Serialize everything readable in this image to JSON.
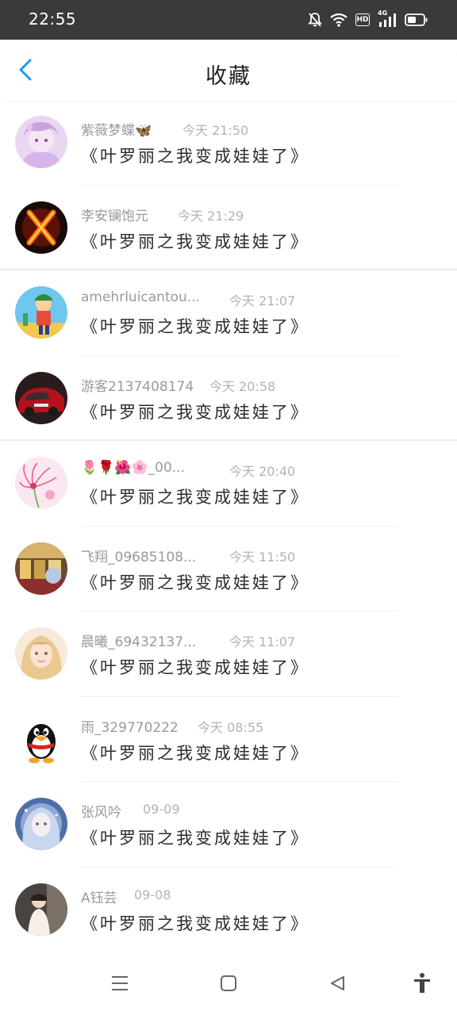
{
  "status_bar": {
    "time": "22:55",
    "hd": "HD",
    "network": "4G"
  },
  "header": {
    "title": "收藏"
  },
  "favorites": [
    {
      "name": "紫薇梦蝶🦋",
      "time": "今天 21:50",
      "content": "《叶罗丽之我变成娃娃了》",
      "avatar": "anime-girl-purple"
    },
    {
      "name": "李安镧饱元",
      "time": "今天 21:29",
      "content": "《叶罗丽之我变成娃娃了》",
      "avatar": "fire-x"
    },
    {
      "name": "amehrluicantou...",
      "time": "今天 21:07",
      "content": "《叶罗丽之我变成娃娃了》",
      "avatar": "cartoon-boy"
    },
    {
      "name": "游客2137408174",
      "time": "今天 20:58",
      "content": "《叶罗丽之我变成娃娃了》",
      "avatar": "red-car"
    },
    {
      "name": "🌷🌹🌺🌸_00...",
      "time": "今天 20:40",
      "content": "《叶罗丽之我变成娃娃了》",
      "avatar": "pink-flowers"
    },
    {
      "name": "飞翔_09685108...",
      "time": "今天 11:50",
      "content": "《叶罗丽之我变成娃娃了》",
      "avatar": "store-photo"
    },
    {
      "name": "晨曦_69432137...",
      "time": "今天 11:07",
      "content": "《叶罗丽之我变成娃娃了》",
      "avatar": "anime-girl-blonde"
    },
    {
      "name": "雨_329770222",
      "time": "今天 08:55",
      "content": "《叶罗丽之我变成娃娃了》",
      "avatar": "qq-penguin"
    },
    {
      "name": "张风吟",
      "time": "09-09",
      "content": "《叶罗丽之我变成娃娃了》",
      "avatar": "anime-girl-blue"
    },
    {
      "name": "A钰芸",
      "time": "09-08",
      "content": "《叶罗丽之我变成娃娃了》",
      "avatar": "girl-photo"
    }
  ],
  "colors": {
    "accent": "#2196F3",
    "status_bar": "#3a3a3a",
    "name": "#9a9a9a",
    "time": "#b3b3b3",
    "content": "#2b2b2b"
  },
  "nav_icons": [
    "menu-icon",
    "home-square-icon",
    "back-triangle-icon",
    "accessibility-icon"
  ]
}
